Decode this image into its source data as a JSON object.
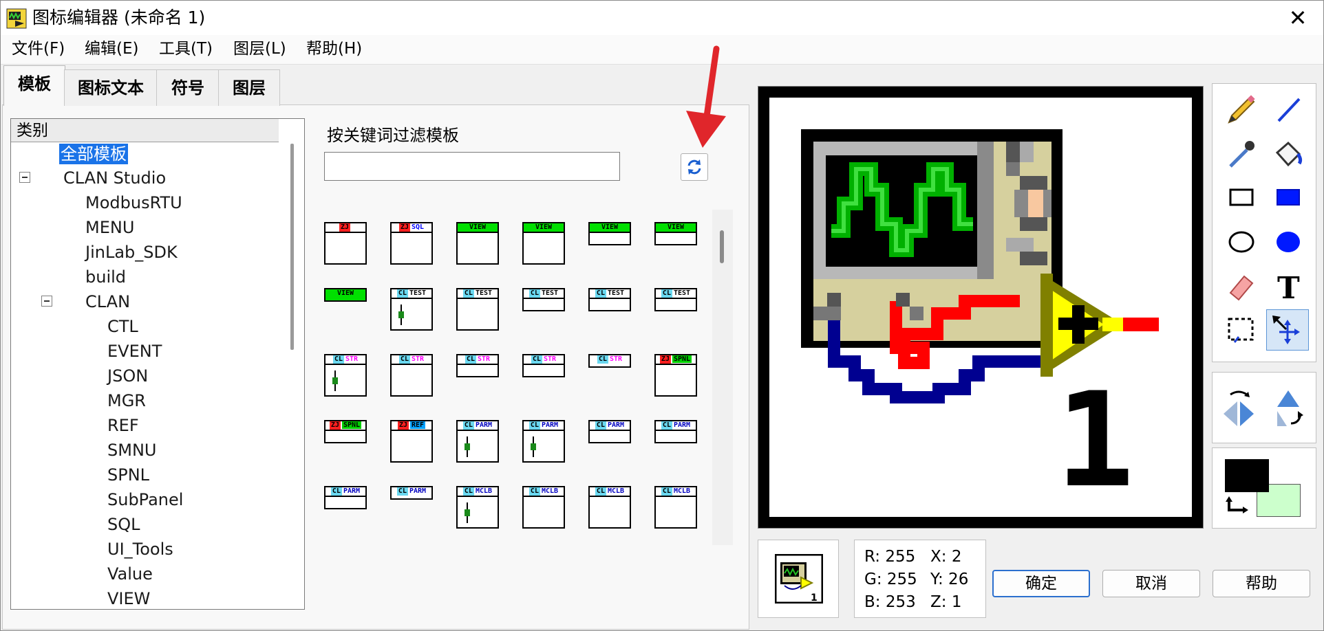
{
  "window": {
    "title": "图标编辑器 (未命名 1)",
    "close_glyph": "✕"
  },
  "menu": [
    "文件(F)",
    "编辑(E)",
    "工具(T)",
    "图层(L)",
    "帮助(H)"
  ],
  "tabs": [
    {
      "label": "模板",
      "active": true
    },
    {
      "label": "图标文本",
      "active": false
    },
    {
      "label": "符号",
      "active": false
    },
    {
      "label": "图层",
      "active": false
    }
  ],
  "category_tree": {
    "header": "类别",
    "items": [
      {
        "label": "全部模板",
        "selected": true
      },
      {
        "label": "CLAN Studio",
        "expanded": true
      },
      {
        "label": "ModbusRTU"
      },
      {
        "label": "MENU"
      },
      {
        "label": "JinLab_SDK"
      },
      {
        "label": "build"
      },
      {
        "label": "CLAN",
        "expanded": true
      },
      {
        "label": "CTL"
      },
      {
        "label": "EVENT"
      },
      {
        "label": "JSON"
      },
      {
        "label": "MGR"
      },
      {
        "label": "REF"
      },
      {
        "label": "SMNU"
      },
      {
        "label": "SPNL"
      },
      {
        "label": "SubPanel"
      },
      {
        "label": "SQL"
      },
      {
        "label": "UI_Tools"
      },
      {
        "label": "Value"
      },
      {
        "label": "VIEW"
      }
    ]
  },
  "filter": {
    "label": "按关键词过滤模板",
    "value": "",
    "refresh_icon": "refresh-icon"
  },
  "templates": [
    [
      {
        "prefix": "ZJ",
        "text": "",
        "color": "#ff2020"
      },
      {
        "prefix": "ZJ",
        "text": "SQL",
        "color": "#0000ff"
      },
      {
        "prefix": "",
        "text": "VIEW",
        "color": "#00e000"
      },
      {
        "prefix": "",
        "text": "VIEW",
        "color": "#00e000"
      },
      {
        "prefix": "",
        "text": "VIEW",
        "color": "#00e000"
      },
      {
        "prefix": "",
        "text": "VIEW",
        "color": "#00e000"
      }
    ],
    [
      {
        "prefix": "",
        "text": "VIEW",
        "color": "#00e000"
      },
      {
        "prefix": "CL",
        "text": "TEST",
        "color": "#000000"
      },
      {
        "prefix": "CL",
        "text": "TEST",
        "color": "#000000"
      },
      {
        "prefix": "CL",
        "text": "TEST",
        "color": "#000000"
      },
      {
        "prefix": "CL",
        "text": "TEST",
        "color": "#000000"
      },
      {
        "prefix": "CL",
        "text": "TEST",
        "color": "#000000"
      }
    ],
    [
      {
        "prefix": "CL",
        "text": "STR",
        "color": "#ff00ff"
      },
      {
        "prefix": "CL",
        "text": "STR",
        "color": "#ff00ff"
      },
      {
        "prefix": "CL",
        "text": "STR",
        "color": "#ff00ff"
      },
      {
        "prefix": "CL",
        "text": "STR",
        "color": "#ff00ff"
      },
      {
        "prefix": "CL",
        "text": "STR",
        "color": "#ff00ff"
      },
      {
        "prefix": "ZJ",
        "text": "SPNL",
        "color": "#00d000"
      }
    ],
    [
      {
        "prefix": "ZJ",
        "text": "SPNL",
        "color": "#00d000"
      },
      {
        "prefix": "ZJ",
        "text": "REF",
        "color": "#00a0ff"
      },
      {
        "prefix": "CL",
        "text": "PARM",
        "color": "#0000c0"
      },
      {
        "prefix": "CL",
        "text": "PARM",
        "color": "#0000c0"
      },
      {
        "prefix": "CL",
        "text": "PARM",
        "color": "#0000c0"
      },
      {
        "prefix": "CL",
        "text": "PARM",
        "color": "#0000c0"
      }
    ],
    [
      {
        "prefix": "CL",
        "text": "PARM",
        "color": "#0000c0"
      },
      {
        "prefix": "CL",
        "text": "PARM",
        "color": "#0000c0"
      },
      {
        "prefix": "CL",
        "text": "MCLB",
        "color": "#0000c0"
      },
      {
        "prefix": "CL",
        "text": "MCLB",
        "color": "#0000c0"
      },
      {
        "prefix": "CL",
        "text": "MCLB",
        "color": "#0000c0"
      },
      {
        "prefix": "CL",
        "text": "MCLB",
        "color": "#0000c0"
      }
    ]
  ],
  "canvas": {
    "number_glyph": "1"
  },
  "tools": [
    "pencil-icon",
    "line-icon",
    "dropper-icon",
    "fill-bucket-icon",
    "rectangle-icon",
    "filled-rectangle-icon",
    "ellipse-icon",
    "filled-ellipse-icon",
    "eraser-icon",
    "text-icon",
    "select-icon",
    "move-icon"
  ],
  "colors": {
    "foreground": "#000000",
    "background": "#ccffcc",
    "accent": "#2b6fce",
    "selection": "#1a73e8"
  },
  "info": {
    "r": "R: 255",
    "g": "G: 255",
    "b": "B: 253",
    "x": "X: 2",
    "y": "Y: 26",
    "z": "Z: 1"
  },
  "buttons": {
    "ok": "确定",
    "cancel": "取消",
    "help": "帮助"
  },
  "preview": {
    "number_glyph": "1"
  }
}
